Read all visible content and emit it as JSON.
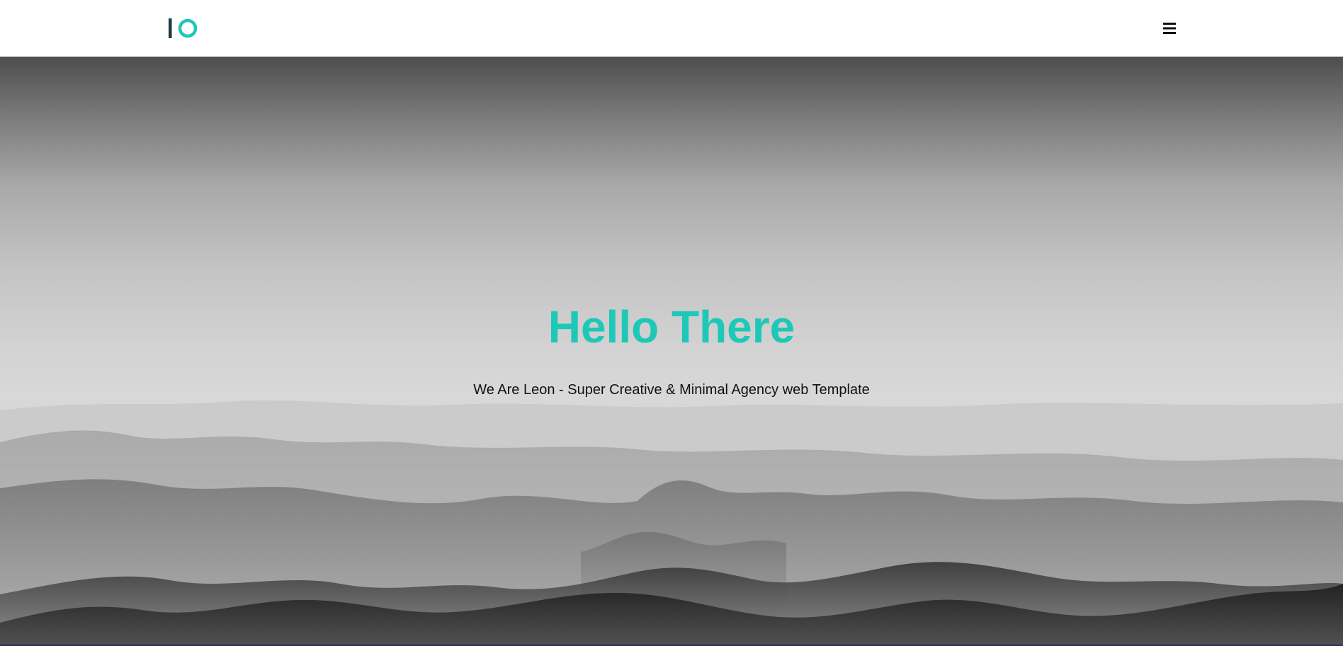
{
  "colors": {
    "accent": "#1ec8b7",
    "logo_dark": "#1d3a44",
    "header_bg": "#ffffff",
    "subtitle_text": "#111111"
  },
  "header": {
    "logo_icon": "io-logo-icon",
    "menu_icon": "hamburger-menu-icon"
  },
  "hero": {
    "background": "misty-mountains-grayscale-image",
    "title": "Hello There",
    "subtitle": "We Are Leon - Super Creative & Minimal Agency web Template"
  }
}
